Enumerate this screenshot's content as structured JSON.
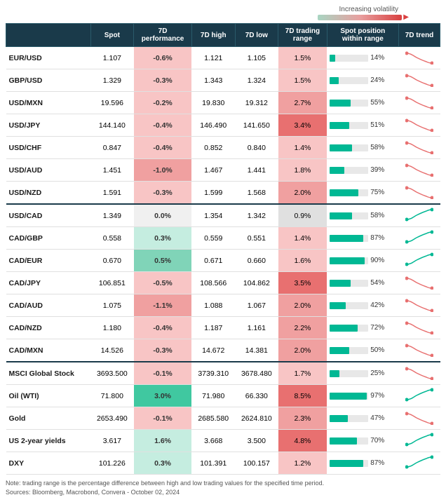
{
  "header": {
    "volatility_label": "Increasing volatility",
    "columns": [
      "",
      "Spot",
      "7D\nperformance",
      "7D high",
      "7D low",
      "7D trading\nrange",
      "Spot position\nwithin range",
      "7D trend"
    ]
  },
  "sections": [
    {
      "rows": [
        {
          "pair": "EUR/USD",
          "spot": "1.107",
          "perf": "-0.6%",
          "perf_class": "perf-negative-light",
          "high": "1.121",
          "low": "1.105",
          "range": "1.5%",
          "range_color": "#f8c5c5",
          "pos_pct": 14,
          "trend_dir": "down"
        },
        {
          "pair": "GBP/USD",
          "spot": "1.329",
          "perf": "-0.3%",
          "perf_class": "perf-negative-light",
          "high": "1.343",
          "low": "1.324",
          "range": "1.5%",
          "range_color": "#f8c5c5",
          "pos_pct": 24,
          "trend_dir": "down"
        },
        {
          "pair": "USD/MXN",
          "spot": "19.596",
          "perf": "-0.2%",
          "perf_class": "perf-negative-light",
          "high": "19.830",
          "low": "19.312",
          "range": "2.7%",
          "range_color": "#f0a0a0",
          "pos_pct": 55,
          "trend_dir": "down"
        },
        {
          "pair": "USD/JPY",
          "spot": "144.140",
          "perf": "-0.4%",
          "perf_class": "perf-negative-light",
          "high": "146.490",
          "low": "141.650",
          "range": "3.4%",
          "range_color": "#e87070",
          "pos_pct": 51,
          "trend_dir": "down"
        },
        {
          "pair": "USD/CHF",
          "spot": "0.847",
          "perf": "-0.4%",
          "perf_class": "perf-negative-light",
          "high": "0.852",
          "low": "0.840",
          "range": "1.4%",
          "range_color": "#f8c5c5",
          "pos_pct": 58,
          "trend_dir": "down"
        },
        {
          "pair": "USD/AUD",
          "spot": "1.451",
          "perf": "-1.0%",
          "perf_class": "perf-negative-medium",
          "high": "1.467",
          "low": "1.441",
          "range": "1.8%",
          "range_color": "#f8c5c5",
          "pos_pct": 39,
          "trend_dir": "down"
        },
        {
          "pair": "USD/NZD",
          "spot": "1.591",
          "perf": "-0.3%",
          "perf_class": "perf-negative-light",
          "high": "1.599",
          "low": "1.568",
          "range": "2.0%",
          "range_color": "#f0a0a0",
          "pos_pct": 75,
          "trend_dir": "down"
        }
      ]
    },
    {
      "rows": [
        {
          "pair": "USD/CAD",
          "spot": "1.349",
          "perf": "0.0%",
          "perf_class": "perf-neutral",
          "high": "1.354",
          "low": "1.342",
          "range": "0.9%",
          "range_color": "#e0e0e0",
          "pos_pct": 58,
          "trend_dir": "up"
        },
        {
          "pair": "CAD/GBP",
          "spot": "0.558",
          "perf": "0.3%",
          "perf_class": "perf-positive-light",
          "high": "0.559",
          "low": "0.551",
          "range": "1.4%",
          "range_color": "#f8c5c5",
          "pos_pct": 87,
          "trend_dir": "up"
        },
        {
          "pair": "CAD/EUR",
          "spot": "0.670",
          "perf": "0.5%",
          "perf_class": "perf-positive-medium",
          "high": "0.671",
          "low": "0.660",
          "range": "1.6%",
          "range_color": "#f8c5c5",
          "pos_pct": 90,
          "trend_dir": "up"
        },
        {
          "pair": "CAD/JPY",
          "spot": "106.851",
          "perf": "-0.5%",
          "perf_class": "perf-negative-light",
          "high": "108.566",
          "low": "104.862",
          "range": "3.5%",
          "range_color": "#e87070",
          "pos_pct": 54,
          "trend_dir": "down"
        },
        {
          "pair": "CAD/AUD",
          "spot": "1.075",
          "perf": "-1.1%",
          "perf_class": "perf-negative-medium",
          "high": "1.088",
          "low": "1.067",
          "range": "2.0%",
          "range_color": "#f0a0a0",
          "pos_pct": 42,
          "trend_dir": "down"
        },
        {
          "pair": "CAD/NZD",
          "spot": "1.180",
          "perf": "-0.4%",
          "perf_class": "perf-negative-light",
          "high": "1.187",
          "low": "1.161",
          "range": "2.2%",
          "range_color": "#f0a0a0",
          "pos_pct": 72,
          "trend_dir": "down"
        },
        {
          "pair": "CAD/MXN",
          "spot": "14.526",
          "perf": "-0.3%",
          "perf_class": "perf-negative-light",
          "high": "14.672",
          "low": "14.381",
          "range": "2.0%",
          "range_color": "#f0a0a0",
          "pos_pct": 50,
          "trend_dir": "down"
        }
      ]
    },
    {
      "rows": [
        {
          "pair": "MSCI Global Stock",
          "spot": "3693.500",
          "perf": "-0.1%",
          "perf_class": "perf-negative-light",
          "high": "3739.310",
          "low": "3678.480",
          "range": "1.7%",
          "range_color": "#f8c5c5",
          "pos_pct": 25,
          "trend_dir": "down"
        },
        {
          "pair": "Oil (WTI)",
          "spot": "71.800",
          "perf": "3.0%",
          "perf_class": "perf-positive-strong",
          "high": "71.980",
          "low": "66.330",
          "range": "8.5%",
          "range_color": "#e87070",
          "pos_pct": 97,
          "trend_dir": "up"
        },
        {
          "pair": "Gold",
          "spot": "2653.490",
          "perf": "-0.1%",
          "perf_class": "perf-negative-light",
          "high": "2685.580",
          "low": "2624.810",
          "range": "2.3%",
          "range_color": "#f0a0a0",
          "pos_pct": 47,
          "trend_dir": "down"
        },
        {
          "pair": "US 2-year yields",
          "spot": "3.617",
          "perf": "1.6%",
          "perf_class": "perf-positive-light",
          "high": "3.668",
          "low": "3.500",
          "range": "4.8%",
          "range_color": "#e87070",
          "pos_pct": 70,
          "trend_dir": "up"
        },
        {
          "pair": "DXY",
          "spot": "101.226",
          "perf": "0.3%",
          "perf_class": "perf-positive-light",
          "high": "101.391",
          "low": "100.157",
          "range": "1.2%",
          "range_color": "#f8c5c5",
          "pos_pct": 87,
          "trend_dir": "up"
        }
      ]
    }
  ],
  "footer": {
    "note": "Note: trading range is the percentage difference between high and low trading values for the specified time period.",
    "sources": "Sources: Bloomberg, Macrobond, Convera - October 02, 2024"
  }
}
